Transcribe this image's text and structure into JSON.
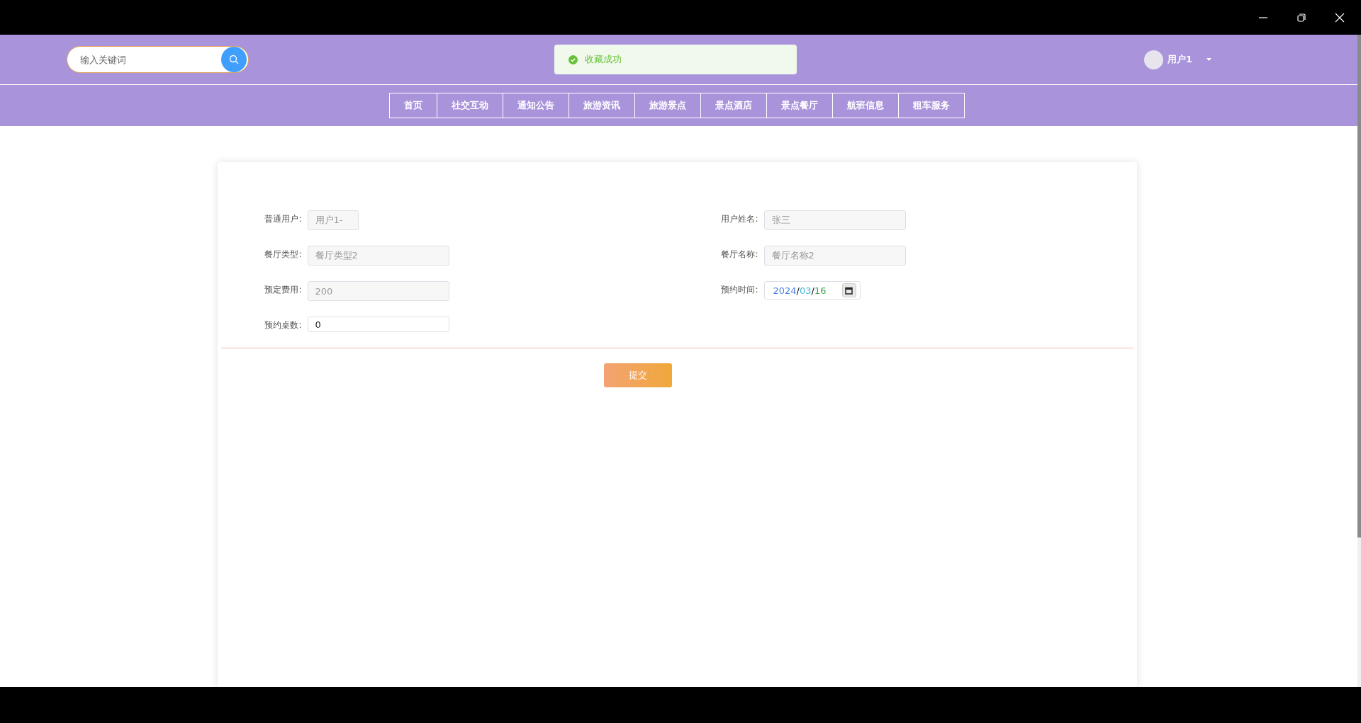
{
  "header": {
    "search": {
      "placeholder": "输入关键词"
    },
    "toast": {
      "text": "收藏成功"
    },
    "user": {
      "name": "用户1"
    }
  },
  "nav": [
    {
      "label": "首页"
    },
    {
      "label": "社交互动"
    },
    {
      "label": "通知公告"
    },
    {
      "label": "旅游资讯"
    },
    {
      "label": "旅游景点"
    },
    {
      "label": "景点酒店"
    },
    {
      "label": "景点餐厅"
    },
    {
      "label": "航班信息"
    },
    {
      "label": "租车服务"
    }
  ],
  "form": {
    "fields": [
      {
        "label": "普通用户:",
        "kind": "short",
        "value": "用户1-",
        "disabled": true
      },
      {
        "label": "用户姓名:",
        "kind": "text",
        "value": "张三",
        "disabled": true
      },
      {
        "label": "餐厅类型:",
        "kind": "text",
        "value": "餐厅类型2",
        "disabled": true
      },
      {
        "label": "餐厅名称:",
        "kind": "text",
        "value": "餐厅名称2",
        "disabled": true
      },
      {
        "label": "预定费用:",
        "kind": "text",
        "value": "200",
        "disabled": true
      },
      {
        "label": "预约时间:",
        "kind": "date",
        "value": "2024/03/16",
        "disabled": false
      },
      {
        "label": "预约桌数:",
        "kind": "text",
        "value": "0",
        "disabled": false
      }
    ],
    "submit": "提交"
  }
}
